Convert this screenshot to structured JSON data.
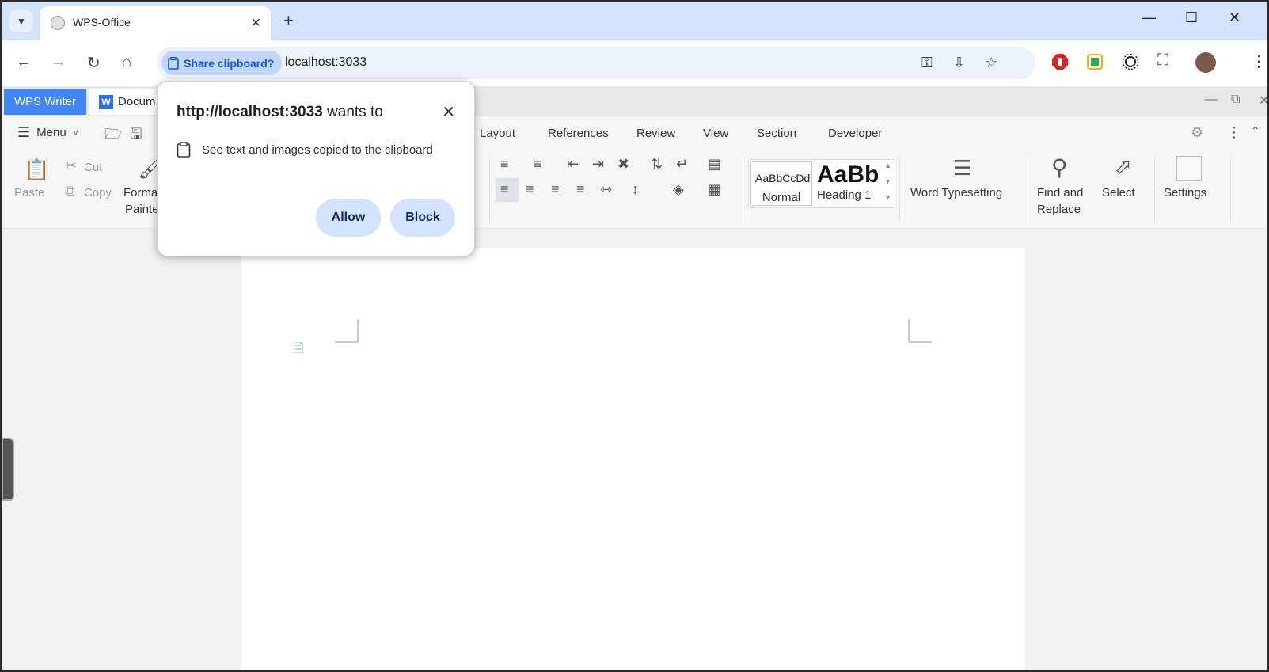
{
  "browser": {
    "tab_title": "WPS-Office",
    "url": "localhost:3033",
    "share_chip_label": "Share clipboard?"
  },
  "wps": {
    "app_tab": "WPS Writer",
    "doc_tab": "Docum",
    "menu_label": "Menu",
    "menu_tabs": [
      "Layout",
      "References",
      "Review",
      "View",
      "Section",
      "Developer"
    ],
    "clipboard": {
      "paste": "Paste",
      "cut": "Cut",
      "copy": "Copy",
      "format_painter_1": "Forma",
      "format_painter_2": "Painte"
    },
    "styles": {
      "normal_sample": "AaBbCcDd",
      "normal_name": "Normal",
      "heading_sample": "AaBb",
      "heading_name": "Heading 1"
    },
    "word_typesetting": "Word Typesetting",
    "find_replace_1": "Find and",
    "find_replace_2": "Replace",
    "select": "Select",
    "settings": "Settings"
  },
  "popup": {
    "origin": "http://localhost:3033",
    "wants_to": " wants to",
    "permission_text": "See text and images copied to the clipboard",
    "allow_label": "Allow",
    "block_label": "Block"
  }
}
